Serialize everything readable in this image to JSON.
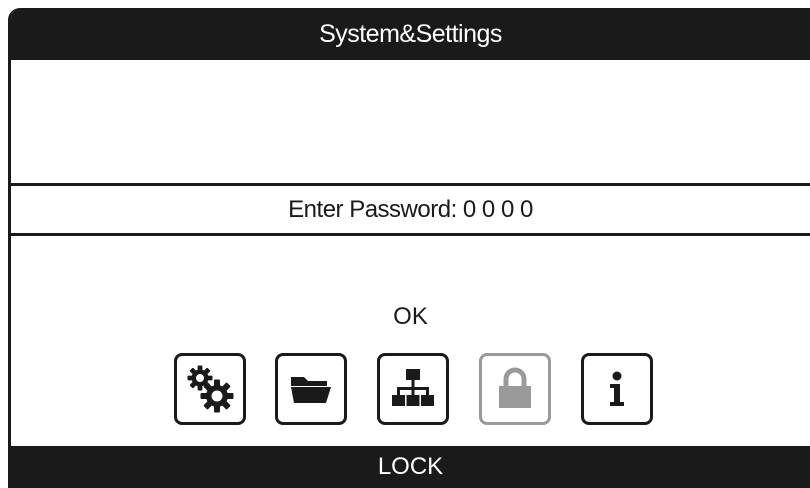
{
  "window": {
    "title": "System&Settings"
  },
  "password": {
    "prompt": "Enter Password: 0 0 0 0"
  },
  "status": {
    "text": "OK"
  },
  "toolbar": {
    "buttons": [
      {
        "icon": "gears-icon",
        "enabled": true
      },
      {
        "icon": "folder-icon",
        "enabled": true
      },
      {
        "icon": "network-icon",
        "enabled": true
      },
      {
        "icon": "lock-icon",
        "enabled": false
      },
      {
        "icon": "info-icon",
        "enabled": true
      }
    ]
  },
  "footer": {
    "label": "LOCK"
  },
  "colors": {
    "bar": "#1a1a1a",
    "background": "#ffffff",
    "disabled": "#9a9a9a"
  }
}
